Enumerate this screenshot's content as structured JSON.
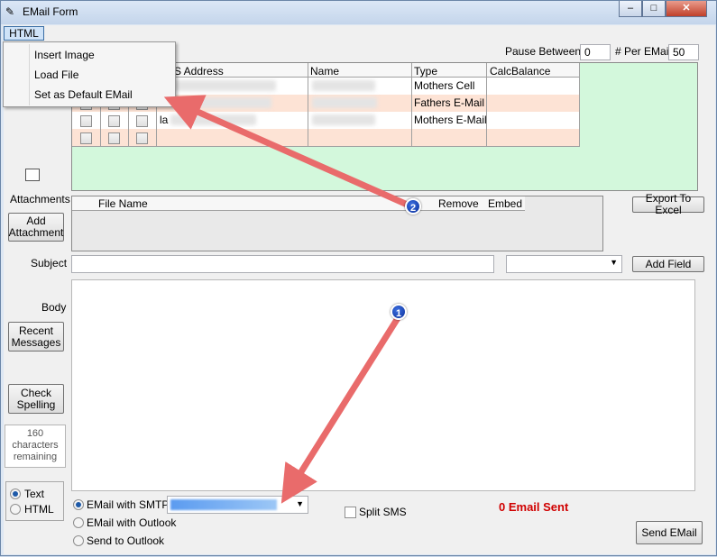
{
  "window": {
    "title": "EMail Form",
    "minimize": "–",
    "maximize": "□",
    "close": "✕"
  },
  "menu": {
    "html_label": "HTML",
    "items": [
      "Insert Image",
      "Load File",
      "Set as Default EMail"
    ]
  },
  "top_controls": {
    "pause_between_label": "Pause Between",
    "pause_between_value": "0",
    "per_email_label": "# Per EMail",
    "per_email_value": "50"
  },
  "recipients_grid": {
    "columns": [
      "S Address",
      "Name",
      "Type",
      "CalcBalance"
    ],
    "rows": [
      {
        "prefix": "",
        "type": "Mothers Cell"
      },
      {
        "prefix": "",
        "type": "Fathers E-Mail"
      },
      {
        "prefix": "la",
        "type": "Mothers E-Mail"
      },
      {
        "prefix": "",
        "type": ""
      }
    ]
  },
  "attachments": {
    "label": "Attachments",
    "add_button": "Add Attachment",
    "columns": [
      "File Name",
      "Remove",
      "Embed"
    ],
    "export_button": "Export To Excel"
  },
  "subject": {
    "label": "Subject",
    "value": "",
    "field_select": "",
    "add_field_button": "Add Field"
  },
  "body": {
    "label": "Body",
    "value": ""
  },
  "side_buttons": {
    "recent": "Recent Messages",
    "spell": "Check Spelling",
    "chars_count": "160",
    "chars_text": "characters remaining"
  },
  "format": {
    "text": "Text",
    "html": "HTML",
    "selected": "Text"
  },
  "send_method": {
    "smtp": "EMail with SMTP",
    "outlook": "EMail with Outlook",
    "to_outlook": "Send to Outlook",
    "selected": "smtp"
  },
  "split_sms": "Split SMS",
  "status": "0 Email Sent",
  "send_button": "Send EMail",
  "callouts": [
    "1",
    "2"
  ],
  "colors": {
    "green_area": "#d3f8dc",
    "row_alt": "#fde3d5",
    "status_red": "#d00000",
    "arrow": "#e96b6b"
  }
}
